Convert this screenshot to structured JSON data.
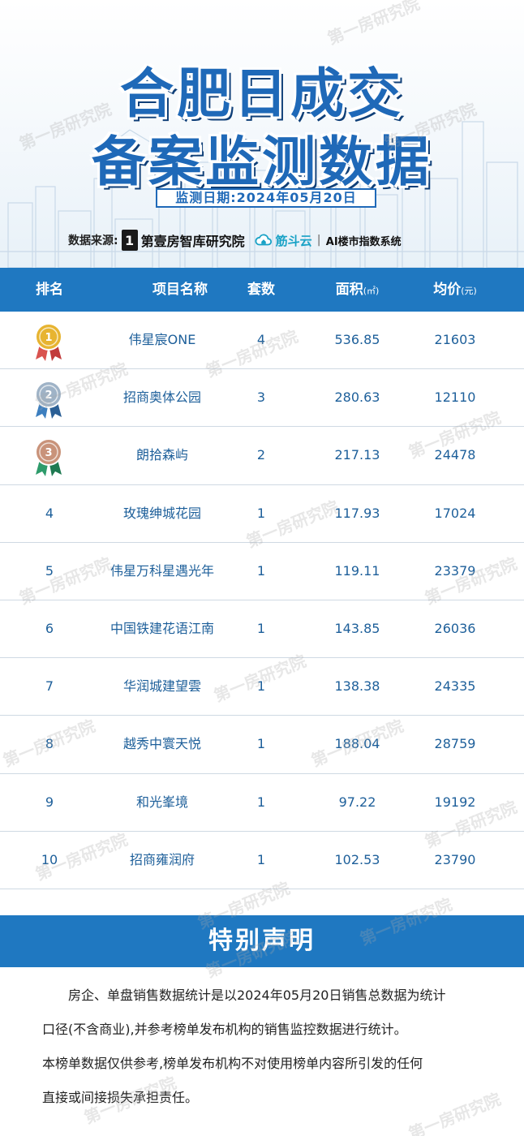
{
  "header": {
    "title_line1": "合肥日成交",
    "title_line2": "备案监测数据",
    "date_label": "监测日期:2024年05月20日",
    "source_label": "数据来源:",
    "source_logo_char": "1",
    "source_brand": "第壹房智库研究院",
    "cloud_brand": "筋斗云",
    "separator": "|",
    "system_name": "AI楼市指数系统"
  },
  "table": {
    "headers": {
      "rank": "排名",
      "name": "项目名称",
      "count": "套数",
      "area": "面积",
      "area_unit": "(㎡)",
      "price": "均价",
      "price_unit": "(元)"
    },
    "rows": [
      {
        "rank": "1",
        "medal": "gold",
        "name": "伟星宸ONE",
        "count": "4",
        "area": "536.85",
        "price": "21603"
      },
      {
        "rank": "2",
        "medal": "silver",
        "name": "招商奥体公园",
        "count": "3",
        "area": "280.63",
        "price": "12110"
      },
      {
        "rank": "3",
        "medal": "bronze",
        "name": "朗拾森屿",
        "count": "2",
        "area": "217.13",
        "price": "24478"
      },
      {
        "rank": "4",
        "name": "玫瑰绅城花园",
        "count": "1",
        "area": "117.93",
        "price": "17024"
      },
      {
        "rank": "5",
        "name": "伟星万科星遇光年",
        "count": "1",
        "area": "119.11",
        "price": "23379"
      },
      {
        "rank": "6",
        "name": "中国铁建花语江南",
        "count": "1",
        "area": "143.85",
        "price": "26036"
      },
      {
        "rank": "7",
        "name": "华润城建望雲",
        "count": "1",
        "area": "138.38",
        "price": "24335"
      },
      {
        "rank": "8",
        "name": "越秀中寰天悦",
        "count": "1",
        "area": "188.04",
        "price": "28759"
      },
      {
        "rank": "9",
        "name": "和光峯境",
        "count": "1",
        "area": "97.22",
        "price": "19192"
      },
      {
        "rank": "10",
        "name": "招商雍润府",
        "count": "1",
        "area": "102.53",
        "price": "23790"
      }
    ]
  },
  "notice": {
    "title": "特别声明",
    "paragraph1_line1": "房企、单盘销售数据统计是以2024年05月20日销售总数据为统计",
    "paragraph1_line2": "口径(不含商业),并参考榜单发布机构的销售监控数据进行统计。",
    "paragraph2_line1": "本榜单数据仅供参考,榜单发布机构不对使用榜单内容所引发的任何",
    "paragraph2_line2": "直接或间接损失承担责任。"
  },
  "watermark_text": "第一房研究院",
  "colors": {
    "primary": "#1f78c1",
    "title": "#1f69b8",
    "text": "#1d5f9a",
    "gold": "#e7b431",
    "silver": "#9fb3c7",
    "bronze": "#c9937a"
  }
}
